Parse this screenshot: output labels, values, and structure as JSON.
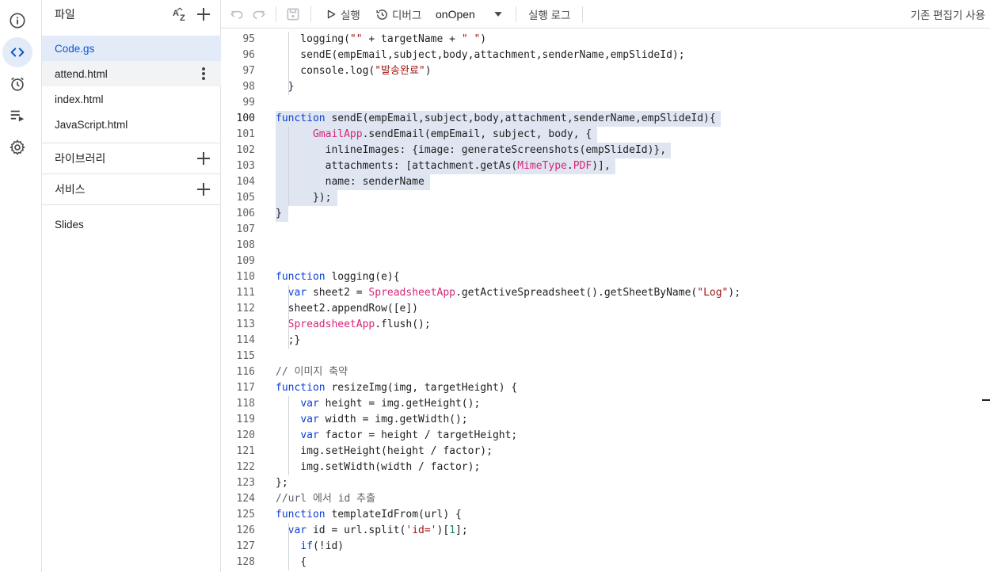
{
  "files_panel": {
    "title": "파일",
    "files": [
      "Code.gs",
      "attend.html",
      "index.html",
      "JavaScript.html"
    ],
    "libraries_label": "라이브러리",
    "services_label": "서비스",
    "services": [
      "Slides"
    ]
  },
  "toolbar": {
    "run_label": "실행",
    "debug_label": "디버그",
    "function_select": "onOpen",
    "log_label": "실행 로그",
    "legacy_editor_label": "기존 편집기 사용"
  },
  "editor": {
    "lines": [
      {
        "n": "95",
        "text": "    logging(\"\" + targetName + \" \")"
      },
      {
        "n": "96",
        "text": "    sendE(empEmail,subject,body,attachment,senderName,empSlideId);"
      },
      {
        "n": "97",
        "text": "    console.log(\"발송완료\")"
      },
      {
        "n": "98",
        "text": "  }"
      },
      {
        "n": "99",
        "text": ""
      },
      {
        "n": "100",
        "text": "function sendE(empEmail,subject,body,attachment,senderName,empSlideId){"
      },
      {
        "n": "101",
        "text": "      GmailApp.sendEmail(empEmail, subject, body, {"
      },
      {
        "n": "102",
        "text": "        inlineImages: {image: generateScreenshots(empSlideId)},"
      },
      {
        "n": "103",
        "text": "        attachments: [attachment.getAs(MimeType.PDF)],"
      },
      {
        "n": "104",
        "text": "        name: senderName"
      },
      {
        "n": "105",
        "text": "      });"
      },
      {
        "n": "106",
        "text": "}"
      },
      {
        "n": "107",
        "text": ""
      },
      {
        "n": "108",
        "text": ""
      },
      {
        "n": "109",
        "text": ""
      },
      {
        "n": "110",
        "text": "function logging(e){"
      },
      {
        "n": "111",
        "text": "  var sheet2 = SpreadsheetApp.getActiveSpreadsheet().getSheetByName(\"Log\");"
      },
      {
        "n": "112",
        "text": "  sheet2.appendRow([e])"
      },
      {
        "n": "113",
        "text": "  SpreadsheetApp.flush();"
      },
      {
        "n": "114",
        "text": "  ;}"
      },
      {
        "n": "115",
        "text": ""
      },
      {
        "n": "116",
        "text": "// 이미지 축약"
      },
      {
        "n": "117",
        "text": "function resizeImg(img, targetHeight) {"
      },
      {
        "n": "118",
        "text": "    var height = img.getHeight();"
      },
      {
        "n": "119",
        "text": "    var width = img.getWidth();"
      },
      {
        "n": "120",
        "text": "    var factor = height / targetHeight;"
      },
      {
        "n": "121",
        "text": "    img.setHeight(height / factor);"
      },
      {
        "n": "122",
        "text": "    img.setWidth(width / factor);"
      },
      {
        "n": "123",
        "text": "};"
      },
      {
        "n": "124",
        "text": "//url 에서 id 추출"
      },
      {
        "n": "125",
        "text": "function templateIdFrom(url) {"
      },
      {
        "n": "126",
        "text": "  var id = url.split('id=')[1];"
      },
      {
        "n": "127",
        "text": "    if(!id)"
      },
      {
        "n": "128",
        "text": "    {"
      }
    ]
  }
}
